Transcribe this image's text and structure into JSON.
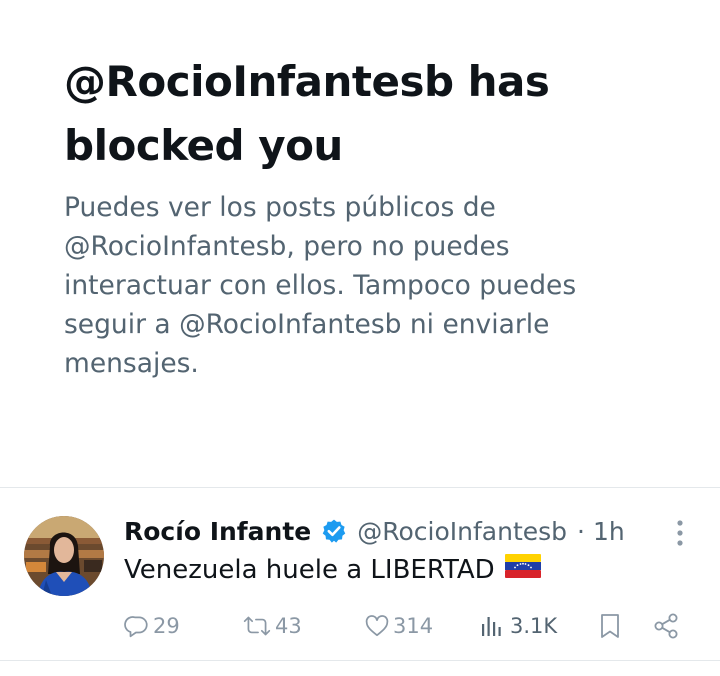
{
  "block_notice": {
    "title_line1": "@RocioInfantesb has",
    "title_line2": "blocked you",
    "desc_line1": "Puedes ver los posts públicos de",
    "desc_line2": "@RocioInfantesb, pero no puedes",
    "desc_line3": "interactuar con ellos. Tampoco puedes",
    "desc_line4": "seguir a @RocioInfantesb ni enviarle",
    "desc_line5": "mensajes."
  },
  "post": {
    "author_name": "Rocío Infante",
    "handle": "@RocioInfantesb",
    "separator": "·",
    "timestamp": "1h",
    "text": "Venezuela huele a LIBERTAD",
    "flag_icon": "venezuela-flag-icon",
    "actions": {
      "replies": "29",
      "reposts": "43",
      "likes": "314",
      "views": "3.1K"
    }
  },
  "colors": {
    "primary_text": "#0f1419",
    "secondary_text": "#536471",
    "action_icon": "#8b98a5",
    "verified_badge": "#1d9bf0",
    "divider": "#e4e8eb"
  },
  "icons": {
    "verified": "verified-badge-icon",
    "more": "more-vertical-icon",
    "reply": "reply-icon",
    "repost": "repost-icon",
    "like": "heart-icon",
    "views": "views-icon",
    "bookmark": "bookmark-icon",
    "share": "share-icon"
  }
}
